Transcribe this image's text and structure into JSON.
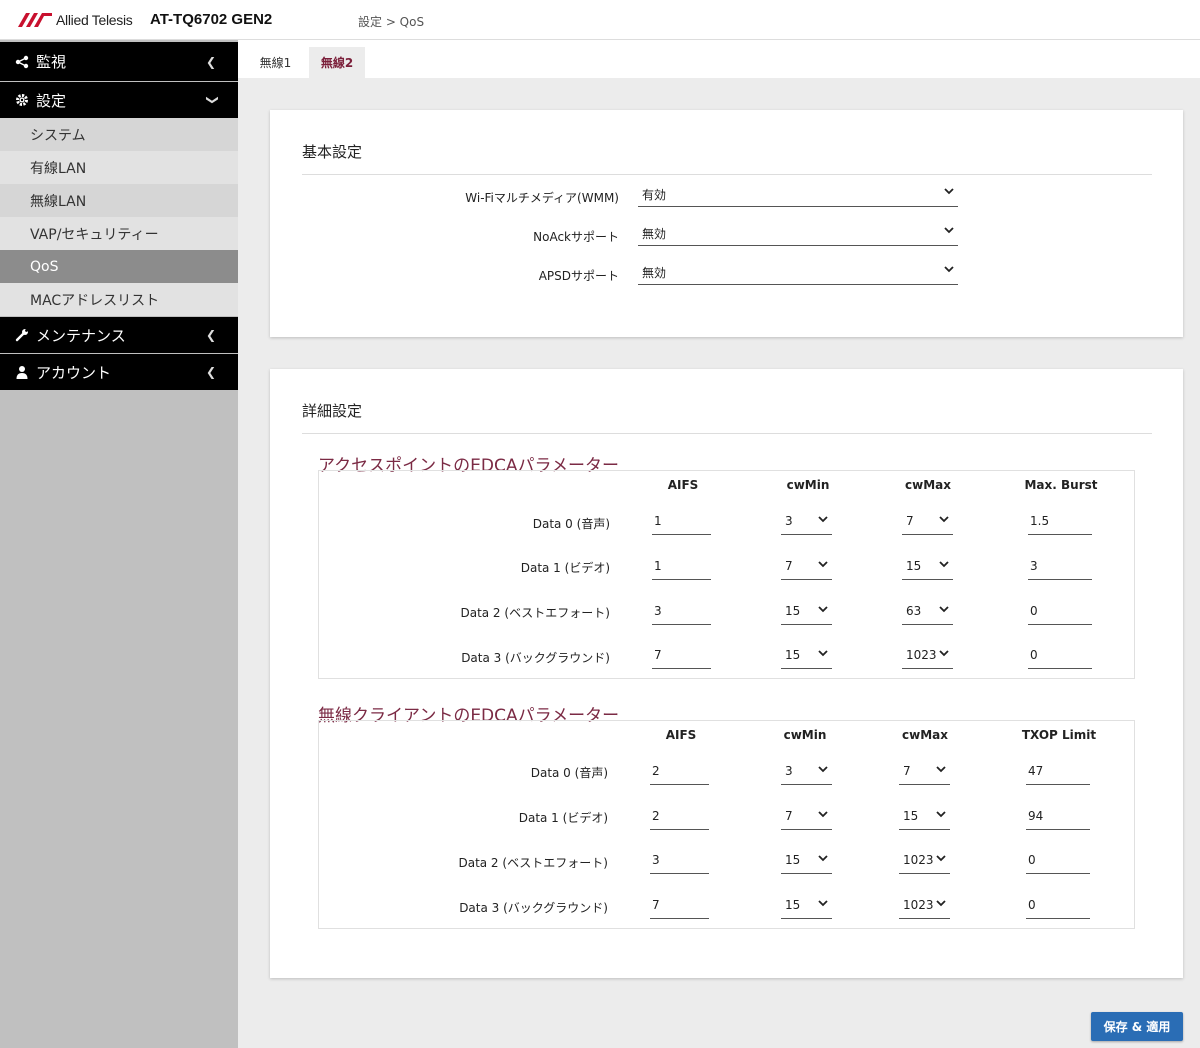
{
  "header": {
    "brand": "Allied Telesis",
    "model": "AT-TQ6702 GEN2",
    "breadcrumb": "設定 > QoS"
  },
  "sidebar": {
    "monitor": "監視",
    "settings": "設定",
    "items": [
      "システム",
      "有線LAN",
      "無線LAN",
      "VAP/セキュリティー",
      "QoS",
      "MACアドレスリスト"
    ],
    "maintenance": "メンテナンス",
    "account": "アカウント"
  },
  "tabs": [
    "無線1",
    "無線2"
  ],
  "basic": {
    "title": "基本設定",
    "fields": [
      {
        "label": "Wi-Fiマルチメディア(WMM)",
        "value": "有効"
      },
      {
        "label": "NoAckサポート",
        "value": "無効"
      },
      {
        "label": "APSDサポート",
        "value": "無効"
      }
    ]
  },
  "advanced": {
    "title": "詳細設定",
    "ap": {
      "title": "アクセスポイントのEDCAパラメーター",
      "headers": [
        "AIFS",
        "cwMin",
        "cwMax",
        "Max. Burst"
      ],
      "rows": [
        {
          "label": "Data 0 (音声)",
          "aifs": "1",
          "cwmin": "3",
          "cwmax": "7",
          "last": "1.5"
        },
        {
          "label": "Data 1 (ビデオ)",
          "aifs": "1",
          "cwmin": "7",
          "cwmax": "15",
          "last": "3"
        },
        {
          "label": "Data 2 (ベストエフォート)",
          "aifs": "3",
          "cwmin": "15",
          "cwmax": "63",
          "last": "0"
        },
        {
          "label": "Data 3 (バックグラウンド)",
          "aifs": "7",
          "cwmin": "15",
          "cwmax": "1023",
          "last": "0"
        }
      ]
    },
    "client": {
      "title": "無線クライアントのEDCAパラメーター",
      "headers": [
        "AIFS",
        "cwMin",
        "cwMax",
        "TXOP Limit"
      ],
      "rows": [
        {
          "label": "Data 0 (音声)",
          "aifs": "2",
          "cwmin": "3",
          "cwmax": "7",
          "last": "47"
        },
        {
          "label": "Data 1 (ビデオ)",
          "aifs": "2",
          "cwmin": "7",
          "cwmax": "15",
          "last": "94"
        },
        {
          "label": "Data 2 (ベストエフォート)",
          "aifs": "3",
          "cwmin": "15",
          "cwmax": "1023",
          "last": "0"
        },
        {
          "label": "Data 3 (バックグラウンド)",
          "aifs": "7",
          "cwmin": "15",
          "cwmax": "1023",
          "last": "0"
        }
      ]
    }
  },
  "save_label": "保存 & 適用"
}
